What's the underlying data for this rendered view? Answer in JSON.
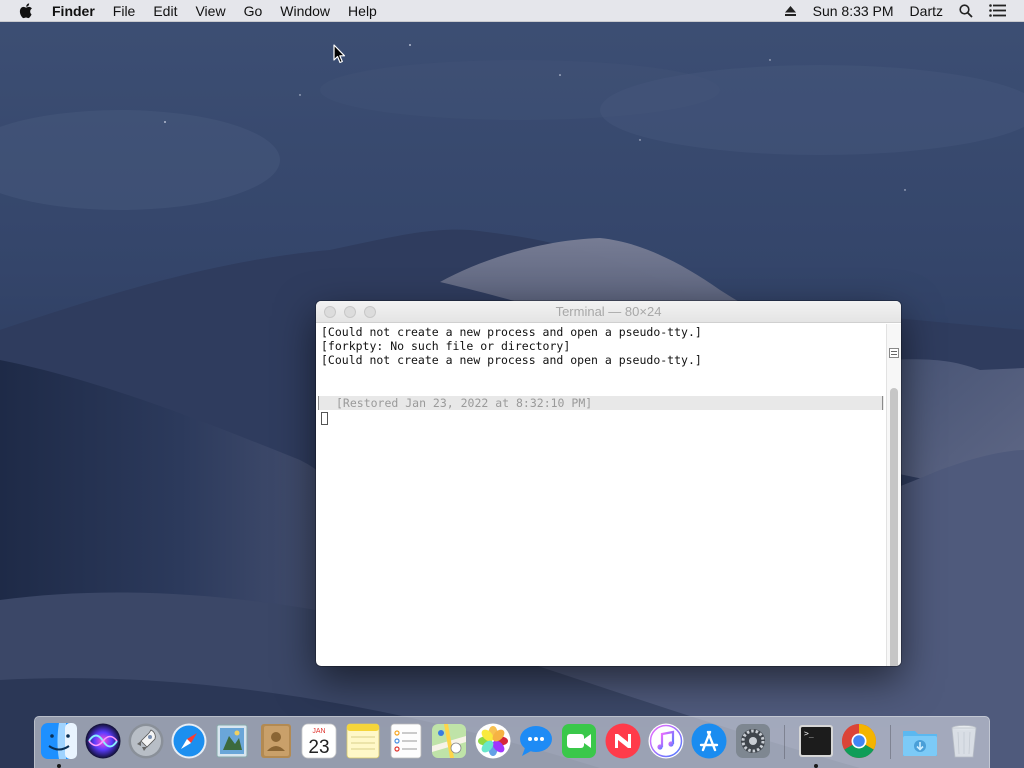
{
  "menubar": {
    "app_name": "Finder",
    "menus": [
      "File",
      "Edit",
      "View",
      "Go",
      "Window",
      "Help"
    ],
    "clock": "Sun 8:33 PM",
    "user": "Dartz"
  },
  "terminal": {
    "title": "Terminal — 80×24",
    "lines": [
      "[Could not create a new process and open a pseudo-tty.]",
      "[forkpty: No such file or directory]",
      "[Could not create a new process and open a pseudo-tty.]"
    ],
    "restored_text": "[Restored Jan 23, 2022 at 8:32:10 PM]"
  },
  "calendar": {
    "month": "JAN",
    "day": "23"
  },
  "dock": {
    "apps": [
      "finder-icon",
      "siri-icon",
      "launchpad-icon",
      "safari-icon",
      "mail-icon",
      "contacts-icon",
      "calendar-icon",
      "notes-icon",
      "reminders-icon",
      "maps-icon",
      "photos-icon",
      "messages-icon",
      "facetime-icon",
      "news-icon",
      "itunes-icon",
      "app-store-icon",
      "system-preferences-icon",
      "terminal-icon",
      "chrome-icon",
      "downloads-icon",
      "trash-icon"
    ],
    "running": [
      "finder-icon",
      "terminal-icon"
    ]
  }
}
